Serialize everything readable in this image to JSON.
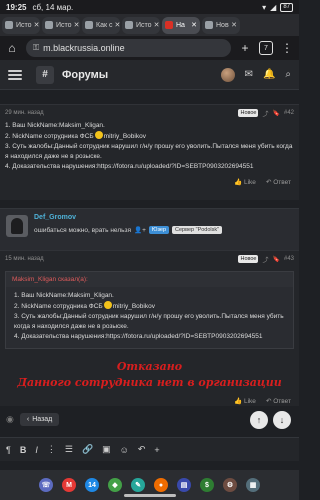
{
  "status_bar": {
    "time": "19:25",
    "date": "сб, 14 мар.",
    "battery": "87"
  },
  "tabs": [
    {
      "label": "Исто",
      "active": false,
      "favicon": "gray"
    },
    {
      "label": "Исто",
      "active": false,
      "favicon": "gray"
    },
    {
      "label": "Как с",
      "active": false,
      "favicon": "gray"
    },
    {
      "label": "Исто",
      "active": false,
      "favicon": "gray"
    },
    {
      "label": "На",
      "active": true,
      "favicon": "red"
    },
    {
      "label": "Нов",
      "active": false,
      "favicon": "gray"
    }
  ],
  "address_bar": {
    "url": "m.blackrussia.online",
    "tabs_count": "7"
  },
  "site_header": {
    "title": "Форумы",
    "logo_glyph": "#"
  },
  "post_42": {
    "time": "29 мин. назад",
    "badge": "Новое",
    "number": "#42",
    "lines": [
      "1. Ваш NickName:Maksim_Kligan.",
      "2. NickName сотрудника ФСБ",
      "mitriy_Bobikov",
      "3. Суть жалобы:Данный сотрудник нарушил г/н/у прошу его уволить.Пытался меня убить когда я находился даже не в розыске.",
      "4. Доказательства нарушения:https://fotora.ru/uploaded/?ID=SEBTP0903202694551"
    ],
    "like": "Like",
    "reply": "Ответ"
  },
  "user": {
    "name": "Def_Gromov",
    "status": "ошибаться можно, врать нельзя",
    "tag_role": "Юзер",
    "tag_server": "Сервер \"Podolsk\""
  },
  "post_43": {
    "time": "15 мин. назад",
    "badge": "Новое",
    "number": "#43",
    "quote_author": "Maksim_Kligan сказал(а):",
    "quote_lines": [
      "1. Ваш NickName:Maksim_Kligan.",
      "2. NickName сотрудника ФСБ",
      "mitriy_Bobikov",
      "3. Суть жалобы:Данный сотрудник нарушил г/н/у прошу его уволить.Пытался меня убить когда я находился даже не в розыске.",
      "4. Доказательства нарушения:https://fotora.ru/uploaded/?ID=SEBTP0903202694551"
    ],
    "verdict_1": "Отказано",
    "verdict_2": "Данного сотрудника нет в организации",
    "like": "Like",
    "reply": "Ответ"
  },
  "back_bar": {
    "back_label": "Назад"
  },
  "colors": {
    "accent": "#4fb3d9",
    "verdict": "#d81e1e",
    "quote_author": "#e05b5b"
  }
}
